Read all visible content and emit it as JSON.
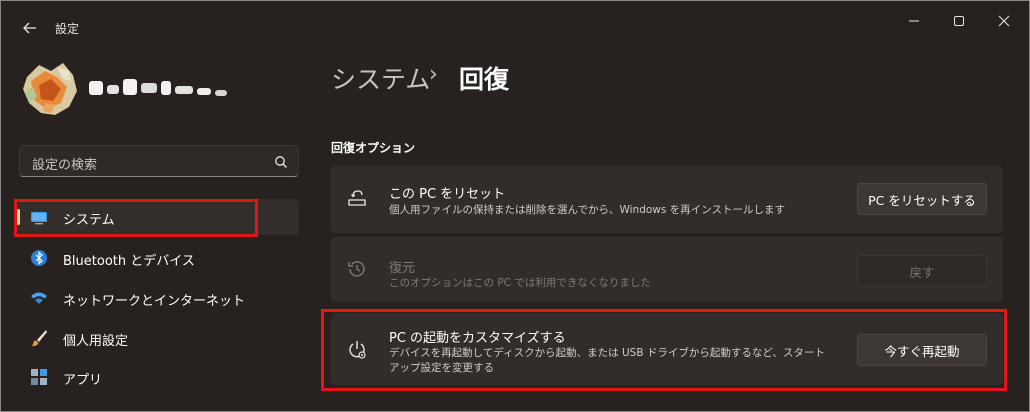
{
  "window": {
    "title": "設定"
  },
  "search": {
    "placeholder": "設定の検索"
  },
  "sidebar": {
    "items": [
      {
        "label": "システム",
        "icon": "system-monitor-icon",
        "active": true
      },
      {
        "label": "Bluetooth とデバイス",
        "icon": "bluetooth-icon"
      },
      {
        "label": "ネットワークとインターネット",
        "icon": "wifi-icon"
      },
      {
        "label": "個人用設定",
        "icon": "paintbrush-icon"
      },
      {
        "label": "アプリ",
        "icon": "apps-icon"
      }
    ]
  },
  "breadcrumb": {
    "parent": "システム",
    "separator": "›",
    "current": "回復"
  },
  "section": {
    "title": "回復オプション"
  },
  "options": [
    {
      "title": "この PC をリセット",
      "description": "個人用ファイルの保持または削除を選んでから、Windows を再インストールします",
      "button": "PC をリセットする",
      "icon": "reset-pc-icon",
      "enabled": true
    },
    {
      "title": "復元",
      "description": "このオプションはこの PC では利用できなくなりました",
      "button": "戻す",
      "icon": "history-icon",
      "enabled": false
    },
    {
      "title": "PC の起動をカスタマイズする",
      "description": "デバイスを再起動してディスクから起動、または USB ドライブから起動するなど、スタートアップ設定を変更する",
      "button": "今すぐ再起動",
      "icon": "advanced-startup-icon",
      "enabled": true
    }
  ],
  "colors": {
    "highlight": "#e0161b",
    "accent": "#e6dc92",
    "background": "#272220",
    "card": "#322d2b"
  }
}
